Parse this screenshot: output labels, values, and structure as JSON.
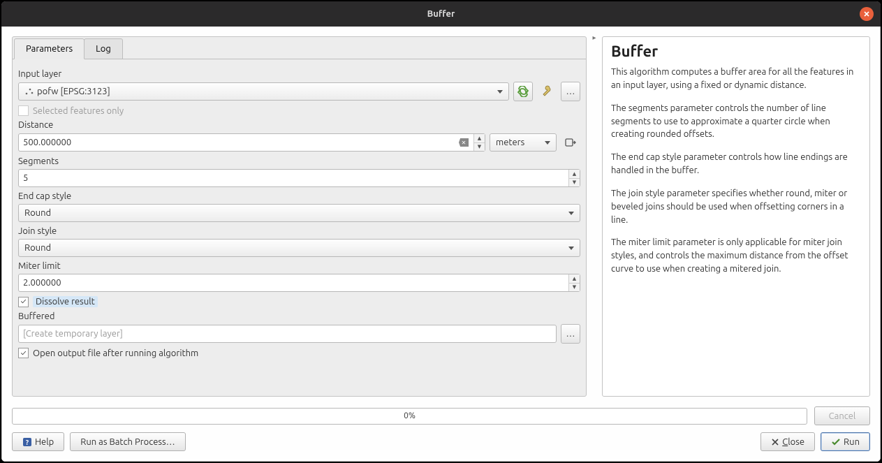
{
  "window": {
    "title": "Buffer"
  },
  "tabs": {
    "parameters": "Parameters",
    "log": "Log"
  },
  "labels": {
    "input_layer": "Input layer",
    "selected_only": "Selected features only",
    "distance": "Distance",
    "segments": "Segments",
    "end_cap": "End cap style",
    "join_style": "Join style",
    "miter_limit": "Miter limit",
    "dissolve": "Dissolve result",
    "buffered": "Buffered",
    "open_output": "Open output file after running algorithm"
  },
  "values": {
    "input_layer": "pofw [EPSG:3123]",
    "distance": "500.000000",
    "units": "meters",
    "segments": "5",
    "end_cap": "Round",
    "join_style": "Round",
    "miter_limit": "2.000000",
    "buffered_placeholder": "[Create temporary layer]",
    "dissolve_checked": true,
    "open_output_checked": true,
    "selected_only_checked": false
  },
  "progress": {
    "text": "0%"
  },
  "buttons": {
    "help": "Help",
    "batch": "Run as Batch Process…",
    "cancel": "Cancel",
    "close": "Close",
    "run": "Run",
    "ellipsis": "…"
  },
  "help": {
    "title": "Buffer",
    "p1": "This algorithm computes a buffer area for all the features in an input layer, using a fixed or dynamic distance.",
    "p2": "The segments parameter controls the number of line segments to use to approximate a quarter circle when creating rounded offsets.",
    "p3": "The end cap style parameter controls how line endings are handled in the buffer.",
    "p4": "The join style parameter specifies whether round, miter or beveled joins should be used when offsetting corners in a line.",
    "p5": "The miter limit parameter is only applicable for miter join styles, and controls the maximum distance from the offset curve to use when creating a mitered join."
  }
}
